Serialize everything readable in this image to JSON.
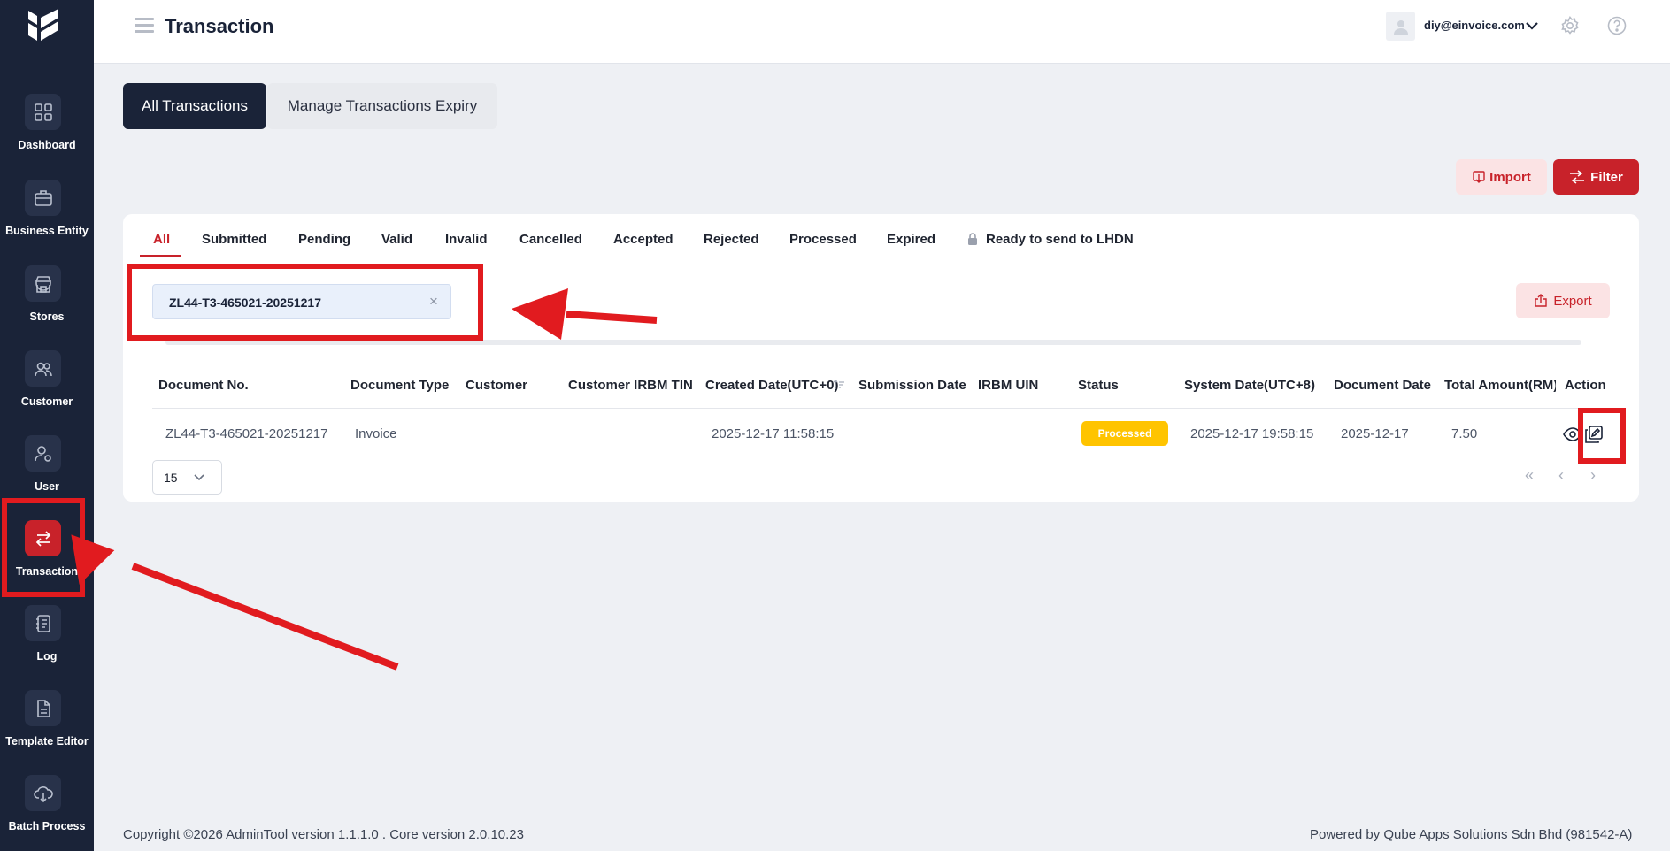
{
  "header": {
    "title": "Transaction",
    "user_email": "diy@einvoice.com"
  },
  "sidebar": {
    "items": [
      {
        "label": "Dashboard",
        "icon": "grid-icon"
      },
      {
        "label": "Business Entity",
        "icon": "briefcase-icon"
      },
      {
        "label": "Stores",
        "icon": "store-icon"
      },
      {
        "label": "Customer",
        "icon": "users-icon"
      },
      {
        "label": "User",
        "icon": "user-gear-icon"
      },
      {
        "label": "Transaction",
        "icon": "swap-icon",
        "active": true
      },
      {
        "label": "Log",
        "icon": "notebook-icon"
      },
      {
        "label": "Template Editor",
        "icon": "document-icon"
      },
      {
        "label": "Batch Process",
        "icon": "cloud-download-icon"
      }
    ]
  },
  "top_tabs": {
    "all_transactions": "All Transactions",
    "manage_expiry": "Manage Transactions Expiry"
  },
  "actions": {
    "import_label": "Import",
    "filter_label": "Filter",
    "export_label": "Export"
  },
  "status_tabs": [
    "All",
    "Submitted",
    "Pending",
    "Valid",
    "Invalid",
    "Cancelled",
    "Accepted",
    "Rejected",
    "Processed",
    "Expired",
    "Ready to send to LHDN"
  ],
  "search": {
    "chip_value": "ZL44-T3-465021-20251217"
  },
  "table": {
    "columns": [
      "Document No.",
      "Document Type",
      "Customer",
      "Customer IRBM TIN",
      "Created Date(UTC+0)",
      "Submission Date",
      "IRBM UIN",
      "Status",
      "System Date(UTC+8)",
      "Document Date",
      "Total Amount(RM)",
      "Action"
    ],
    "rows": [
      {
        "document_no": "ZL44-T3-465021-20251217",
        "document_type": "Invoice",
        "customer": "",
        "customer_tin": "",
        "created_date": "2025-12-17 11:58:15",
        "submission_date": "",
        "irbm_uin": "",
        "status": "Processed",
        "system_date": "2025-12-17 19:58:15",
        "document_date": "2025-12-17",
        "total_amount": "7.50"
      }
    ]
  },
  "pagination": {
    "page_size": "15"
  },
  "footer": {
    "left": "Copyright  ©2026  AdminTool version 1.1.1.0    .    Core version 2.0.10.23",
    "right": "Powered by Qube Apps Solutions Sdn Bhd (981542-A)"
  },
  "colors": {
    "sidebar": "#1a2338",
    "accent": "#c8222a",
    "status_processed": "#ffc400",
    "annotation": "#e11b1f"
  }
}
